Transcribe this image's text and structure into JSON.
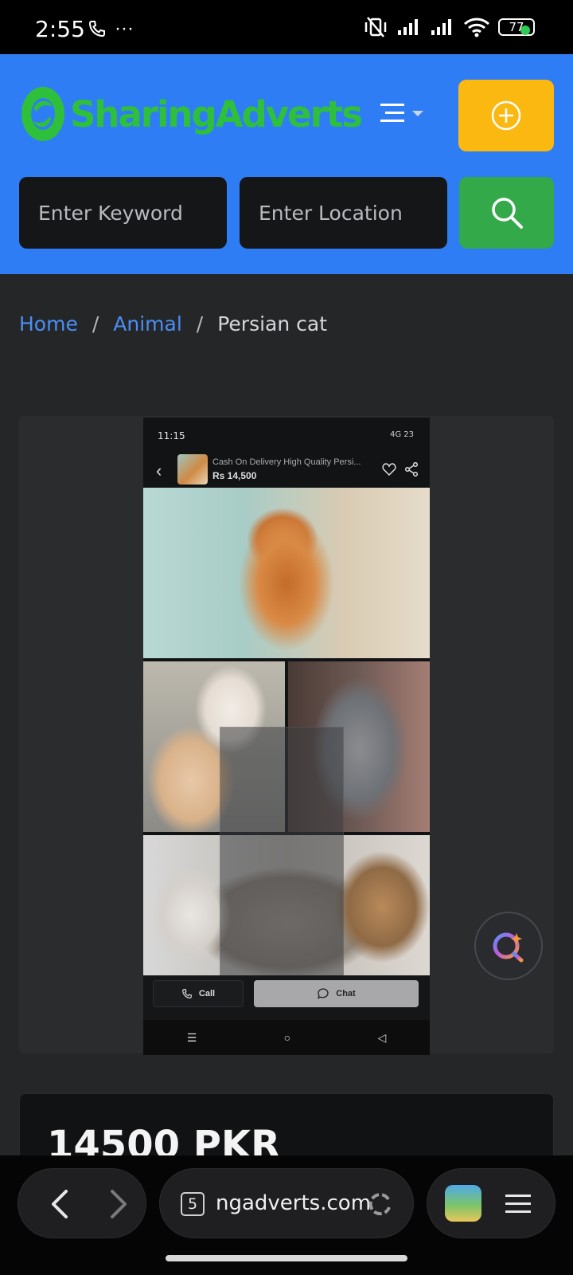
{
  "status_bar": {
    "time": "2:55",
    "more": "···",
    "battery": "77"
  },
  "header": {
    "logo_text": "SharingAdverts",
    "keyword_placeholder": "Enter Keyword",
    "location_placeholder": "Enter Location",
    "colors": {
      "header_bg": "#2f7df4",
      "add_button": "#fbb811",
      "search_button": "#34a94a",
      "logo": "#2fc03b"
    }
  },
  "breadcrumb": {
    "home": "Home",
    "separator": "/",
    "category": "Animal",
    "current": "Persian cat"
  },
  "gallery": {
    "embedded_screenshot": {
      "time": "11:15",
      "status_right": "4G 23",
      "title": "Cash On Delivery High Quality Persi...",
      "price": "Rs 14,500",
      "call_label": "Call",
      "chat_label": "Chat"
    }
  },
  "listing": {
    "price": "14500 PKR"
  },
  "browser": {
    "tab_count": "5",
    "url": "ngadverts.com"
  }
}
